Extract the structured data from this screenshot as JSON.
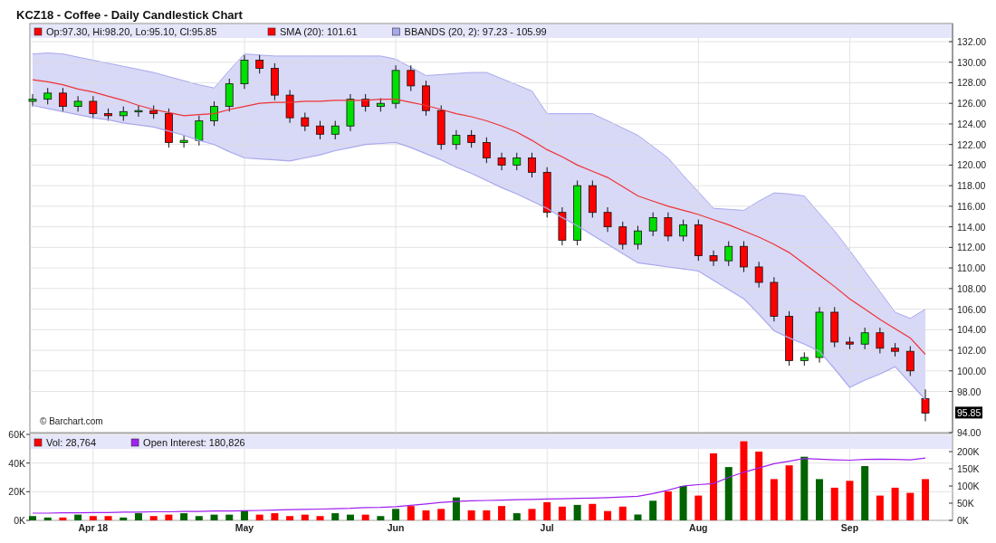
{
  "title": "KCZ18 - Coffee - Daily Candlestick Chart",
  "price_panel": {
    "legend": [
      {
        "label": "Op:97.30, Hi:98.20, Lo:95.10, Cl:95.85",
        "color": "#ff0000"
      },
      {
        "label": "SMA (20): 101.61",
        "color": "#ff0000"
      },
      {
        "label": "BBANDS (20, 2): 97.23 - 105.99",
        "color": "#a8a8ee"
      }
    ],
    "credit": "© Barchart.com",
    "last_price_label": "95.85",
    "chart_data": {
      "type": "candlestick",
      "grid": true,
      "ylim": [
        94,
        132
      ],
      "yticks": [
        {
          "value": 94,
          "label": "94.00"
        },
        {
          "value": 98,
          "label": "98.00"
        },
        {
          "value": 100,
          "label": "100.00"
        },
        {
          "value": 102,
          "label": "102.00"
        },
        {
          "value": 104,
          "label": "104.00"
        },
        {
          "value": 106,
          "label": "106.00"
        },
        {
          "value": 108,
          "label": "108.00"
        },
        {
          "value": 110,
          "label": "110.00"
        },
        {
          "value": 112,
          "label": "112.00"
        },
        {
          "value": 114,
          "label": "114.00"
        },
        {
          "value": 116,
          "label": "116.00"
        },
        {
          "value": 118,
          "label": "118.00"
        },
        {
          "value": 120,
          "label": "120.00"
        },
        {
          "value": 122,
          "label": "122.00"
        },
        {
          "value": 124,
          "label": "124.00"
        },
        {
          "value": 126,
          "label": "126.00"
        },
        {
          "value": 128,
          "label": "128.00"
        },
        {
          "value": 130,
          "label": "130.00"
        },
        {
          "value": 132,
          "label": "132.00"
        }
      ],
      "ohlc": [
        [
          126.2,
          126.9,
          125.7,
          126.4
        ],
        [
          126.4,
          127.5,
          125.9,
          127
        ],
        [
          127,
          127.5,
          125.2,
          125.7
        ],
        [
          125.7,
          126.7,
          125.2,
          126.2
        ],
        [
          126.2,
          126.7,
          124.5,
          125
        ],
        [
          125,
          125.5,
          124.3,
          124.8
        ],
        [
          124.8,
          125.7,
          124.3,
          125.2
        ],
        [
          125.2,
          125.8,
          124.7,
          125.3
        ],
        [
          125.3,
          125.8,
          124.5,
          125
        ],
        [
          125,
          125.5,
          121.7,
          122.2
        ],
        [
          122.2,
          122.9,
          121.7,
          122.4
        ],
        [
          122.4,
          124.8,
          121.9,
          124.3
        ],
        [
          124.3,
          126.2,
          123.8,
          125.7
        ],
        [
          125.7,
          128.4,
          125.2,
          127.9
        ],
        [
          127.9,
          130.7,
          127.4,
          130.2
        ],
        [
          130.2,
          130.7,
          128.9,
          129.4
        ],
        [
          129.4,
          129.9,
          126.3,
          126.8
        ],
        [
          126.8,
          127.3,
          124.1,
          124.6
        ],
        [
          124.6,
          125.1,
          123.3,
          123.8
        ],
        [
          123.8,
          124.3,
          122.5,
          123
        ],
        [
          123,
          124.3,
          122.5,
          123.8
        ],
        [
          123.8,
          126.9,
          123.3,
          126.4
        ],
        [
          126.4,
          126.9,
          125.2,
          125.7
        ],
        [
          125.7,
          126.5,
          125.2,
          126
        ],
        [
          126,
          129.7,
          125.5,
          129.2
        ],
        [
          129.2,
          129.7,
          127.2,
          127.7
        ],
        [
          127.7,
          128.2,
          124.8,
          125.3
        ],
        [
          125.3,
          125.8,
          121.5,
          122
        ],
        [
          122,
          123.4,
          121.5,
          122.9
        ],
        [
          122.9,
          123.4,
          121.7,
          122.2
        ],
        [
          122.2,
          122.7,
          120.2,
          120.7
        ],
        [
          120.7,
          121.2,
          119.5,
          120
        ],
        [
          120,
          121.2,
          119.5,
          120.7
        ],
        [
          120.7,
          121.2,
          118.8,
          119.3
        ],
        [
          119.3,
          119.8,
          114.9,
          115.4
        ],
        [
          115.4,
          115.9,
          112.2,
          112.7
        ],
        [
          112.7,
          118.5,
          112.2,
          118
        ],
        [
          118,
          118.5,
          114.9,
          115.4
        ],
        [
          115.4,
          115.9,
          113.5,
          114
        ],
        [
          114,
          114.5,
          111.8,
          112.3
        ],
        [
          112.3,
          114.1,
          111.8,
          113.6
        ],
        [
          113.6,
          115.4,
          113.1,
          114.9
        ],
        [
          114.9,
          115.4,
          112.6,
          113.1
        ],
        [
          113.1,
          114.7,
          112.6,
          114.2
        ],
        [
          114.2,
          114.7,
          110.7,
          111.2
        ],
        [
          111.2,
          111.7,
          110.2,
          110.7
        ],
        [
          110.7,
          112.6,
          110.2,
          112.1
        ],
        [
          112.1,
          112.6,
          109.6,
          110.1
        ],
        [
          110.1,
          110.6,
          108.1,
          108.6
        ],
        [
          108.6,
          109.1,
          104.8,
          105.3
        ],
        [
          105.3,
          105.8,
          100.5,
          101
        ],
        [
          101,
          101.8,
          100.5,
          101.3
        ],
        [
          101.3,
          106.2,
          100.8,
          105.7
        ],
        [
          105.7,
          106.2,
          102.3,
          102.8
        ],
        [
          102.8,
          103.3,
          102.1,
          102.6
        ],
        [
          102.6,
          104.2,
          102.1,
          103.7
        ],
        [
          103.7,
          104.2,
          101.7,
          102.2
        ],
        [
          102.2,
          102.7,
          101.4,
          101.9
        ],
        [
          101.9,
          102.4,
          99.5,
          100
        ],
        [
          97.3,
          98.2,
          95.1,
          95.9
        ]
      ],
      "series": [
        {
          "type": "area",
          "color": "#a8a8ee",
          "values": [
            130.8,
            130.9,
            130.8,
            130.5,
            130.2,
            129.9,
            129.6,
            129.3,
            129,
            128.6,
            128.2,
            127.8,
            127.5,
            129.2,
            130.8,
            130.7,
            130.6,
            130.6,
            130.6,
            130.6,
            130.6,
            130.6,
            130.6,
            130.6,
            130.3,
            129.5,
            128.7,
            128.8,
            128.9,
            129,
            129,
            128.4,
            127.8,
            127.2,
            125,
            125,
            125,
            125,
            124.3,
            123.6,
            122.9,
            121.8,
            120.7,
            119,
            117.4,
            115.8,
            115.7,
            115.6,
            116.5,
            117.3,
            117.2,
            117,
            115.3,
            113.6,
            111.7,
            109.7,
            107.7,
            105.7,
            105.1,
            106
          ]
        },
        {
          "type": "line",
          "color": "#a8a8ee",
          "values": [
            125.8,
            125.5,
            125.2,
            124.9,
            124.6,
            124.4,
            124.1,
            123.9,
            123.7,
            123.3,
            122.9,
            122.4,
            122,
            121.3,
            120.7,
            120.6,
            120.5,
            120.4,
            120.7,
            121,
            121.4,
            121.7,
            122,
            122.1,
            122.2,
            121.7,
            121.1,
            120.5,
            119.8,
            119.2,
            118.5,
            117.8,
            117.2,
            116.5,
            115.8,
            114.9,
            114.1,
            113.2,
            112.3,
            111.4,
            110.5,
            110.3,
            110.1,
            109.9,
            109.7,
            108.8,
            107.9,
            107,
            105.5,
            103.9,
            103.2,
            102.6,
            101.9,
            100.2,
            98.4,
            99.1,
            99.7,
            100.4,
            98.8,
            97.2
          ]
        },
        {
          "type": "line",
          "color": "#ee3333",
          "values": [
            128.3,
            128.1,
            127.8,
            127.4,
            127.1,
            126.7,
            126.3,
            125.8,
            125.4,
            125.1,
            124.8,
            124.9,
            125,
            125.4,
            125.7,
            126,
            126.1,
            126.1,
            126.2,
            126.2,
            126.3,
            126.3,
            126.3,
            126.4,
            126.4,
            126.1,
            125.8,
            125.4,
            125,
            124.7,
            124.3,
            123.8,
            123.2,
            122.4,
            121.5,
            120.8,
            120,
            119.4,
            118.8,
            117.9,
            117,
            116.5,
            116,
            115.6,
            115.2,
            114.7,
            114.2,
            113.6,
            113,
            112.3,
            111.5,
            110.4,
            109.3,
            108.2,
            107,
            106,
            105,
            104.1,
            103.2,
            101.6
          ]
        }
      ]
    }
  },
  "volume_panel": {
    "legend": [
      {
        "label": "Vol: 28,764",
        "color": "#ff0000"
      },
      {
        "label": "Open Interest: 180,826",
        "color": "#a020f0"
      }
    ],
    "chart_data": {
      "type": "bar",
      "grid": true,
      "categories": [
        null,
        null,
        null,
        null,
        "Apr 18",
        null,
        null,
        null,
        null,
        null,
        null,
        null,
        null,
        null,
        "May",
        null,
        null,
        null,
        null,
        null,
        null,
        null,
        null,
        null,
        "Jun",
        null,
        null,
        null,
        null,
        null,
        null,
        null,
        null,
        null,
        "Jul",
        null,
        null,
        null,
        null,
        null,
        null,
        null,
        null,
        null,
        "Aug",
        null,
        null,
        null,
        null,
        null,
        null,
        null,
        null,
        null,
        "Sep",
        null,
        null,
        null,
        null,
        null
      ],
      "ylim": [
        0,
        60
      ],
      "yticks": [
        {
          "value": 0,
          "label": "0K"
        },
        {
          "value": 20,
          "label": "20K"
        },
        {
          "value": 40,
          "label": "40K"
        },
        {
          "value": 60,
          "label": "60K"
        }
      ],
      "y2lim": [
        0,
        250
      ],
      "y2ticks": [
        {
          "value": 0,
          "label": "0K"
        },
        {
          "value": 50,
          "label": "50K"
        },
        {
          "value": 100,
          "label": "100K"
        },
        {
          "value": 150,
          "label": "150K"
        },
        {
          "value": 200,
          "label": "200K"
        }
      ],
      "series": [
        {
          "type": "bar",
          "values": [
            3,
            2,
            2,
            4,
            3,
            3,
            2,
            5,
            3,
            4,
            5,
            3,
            4,
            4,
            7,
            4,
            5,
            3,
            4,
            3,
            5,
            4,
            4,
            3,
            8,
            10,
            7,
            8,
            16,
            7,
            7,
            10,
            5,
            8,
            12.7,
            9.6,
            10.8,
            11.5,
            6.5,
            9.6,
            4.1,
            13.7,
            20.2,
            24,
            17.3,
            46.8,
            37.2,
            55.2,
            48,
            28.8,
            38.4,
            44.4,
            28.8,
            22.8,
            27.6,
            37.9,
            17.3,
            22.8,
            19.2,
            28.8
          ],
          "colors": [
            "#006400",
            "#006400",
            "#ff0000",
            "#006400",
            "#ff0000",
            "#ff0000",
            "#006400",
            "#006400",
            "#ff0000",
            "#ff0000",
            "#006400",
            "#006400",
            "#006400",
            "#006400",
            "#006400",
            "#ff0000",
            "#ff0000",
            "#ff0000",
            "#ff0000",
            "#ff0000",
            "#006400",
            "#006400",
            "#ff0000",
            "#006400",
            "#006400",
            "#ff0000",
            "#ff0000",
            "#ff0000",
            "#006400",
            "#ff0000",
            "#ff0000",
            "#ff0000",
            "#006400",
            "#ff0000",
            "#ff0000",
            "#ff0000",
            "#006400",
            "#ff0000",
            "#ff0000",
            "#ff0000",
            "#006400",
            "#006400",
            "#ff0000",
            "#006400",
            "#ff0000",
            "#ff0000",
            "#006400",
            "#ff0000",
            "#ff0000",
            "#ff0000",
            "#ff0000",
            "#006400",
            "#006400",
            "#ff0000",
            "#ff0000",
            "#006400",
            "#ff0000",
            "#ff0000",
            "#ff0000",
            "#ff0000"
          ]
        },
        {
          "type": "line",
          "axis": "y2",
          "color": "#a020f0",
          "values": [
            21,
            21,
            22,
            22,
            23,
            23,
            24,
            24,
            25,
            25,
            26,
            26,
            27,
            27,
            28,
            29,
            30,
            31,
            32,
            33,
            34,
            35,
            37,
            38,
            40,
            44,
            48,
            52,
            55,
            57,
            58,
            59,
            60,
            61,
            62,
            63,
            64,
            65,
            66,
            68,
            70,
            78,
            88,
            100,
            104,
            107,
            125,
            140,
            152,
            165,
            172,
            180,
            178,
            176,
            175,
            177,
            178,
            177,
            176,
            181
          ]
        }
      ]
    }
  }
}
